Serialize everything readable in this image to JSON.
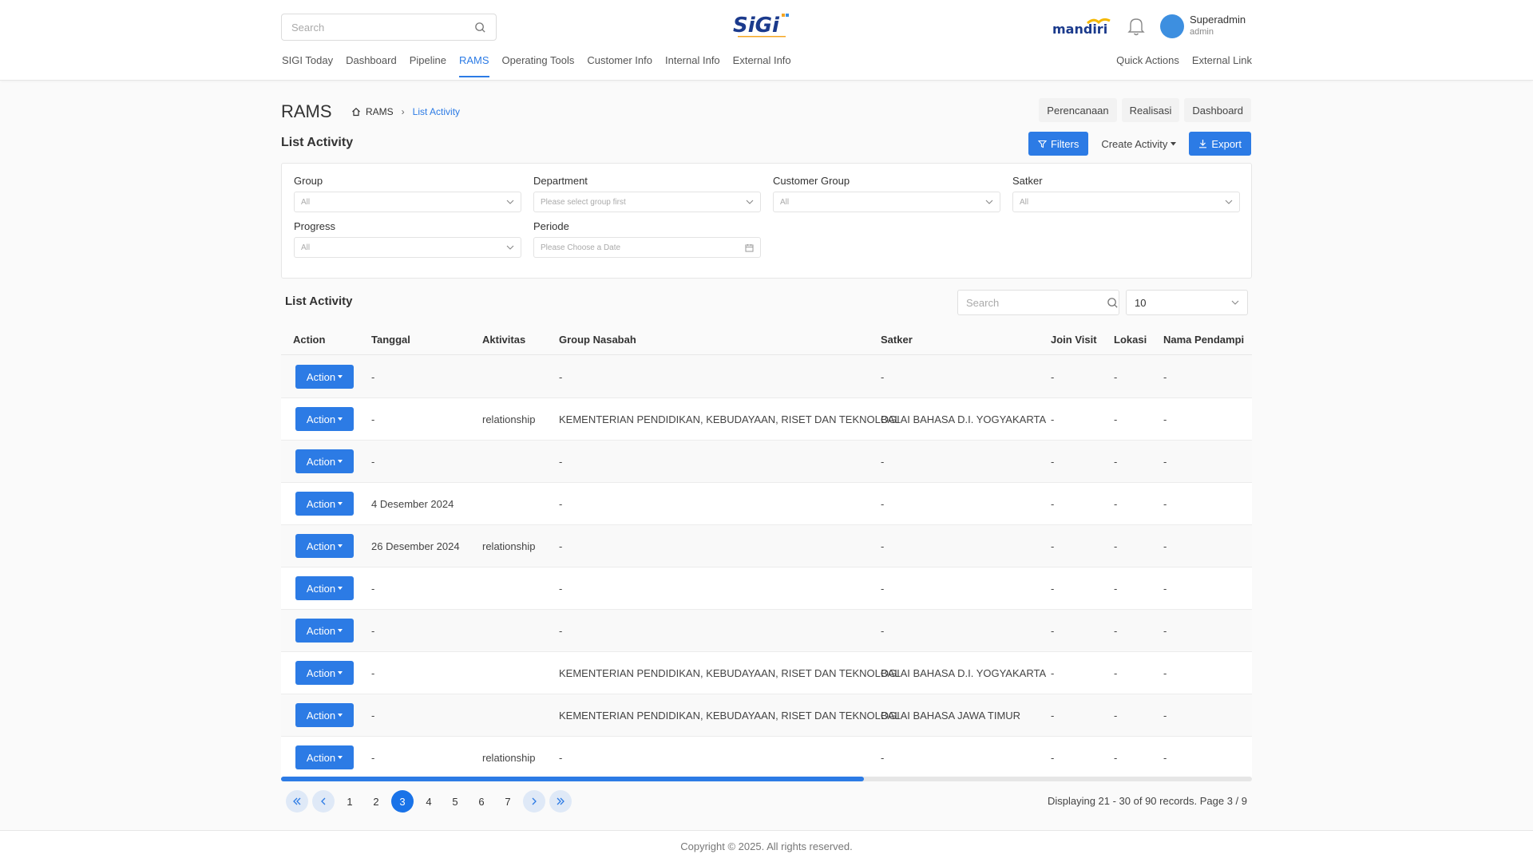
{
  "header": {
    "search_placeholder": "Search",
    "logo_text": "SiGi",
    "brand_text": "mandiri",
    "user": {
      "name": "Superadmin",
      "role": "admin"
    },
    "nav": [
      "SIGI Today",
      "Dashboard",
      "Pipeline",
      "RAMS",
      "Operating Tools",
      "Customer Info",
      "Internal Info",
      "External Info"
    ],
    "nav_active": "RAMS",
    "nav_right": [
      "Quick Actions",
      "External Link"
    ]
  },
  "page": {
    "title": "RAMS",
    "breadcrumb": {
      "root": "RAMS",
      "current": "List Activity"
    },
    "tabs": [
      "Perencanaan",
      "Realisasi",
      "Dashboard"
    ],
    "section_title": "List Activity",
    "buttons": {
      "filters": "Filters",
      "create": "Create Activity",
      "export": "Export"
    }
  },
  "filters": {
    "group": {
      "label": "Group",
      "value": "All"
    },
    "department": {
      "label": "Department",
      "placeholder": "Please select group first"
    },
    "customer_group": {
      "label": "Customer Group",
      "value": "All"
    },
    "satker": {
      "label": "Satker",
      "value": "All"
    },
    "progress": {
      "label": "Progress",
      "value": "All"
    },
    "periode": {
      "label": "Periode",
      "placeholder": "Please Choose a Date"
    }
  },
  "table": {
    "title": "List Activity",
    "search_placeholder": "Search",
    "page_size": "10",
    "action_label": "Action",
    "columns": [
      "Action",
      "Tanggal",
      "Aktivitas",
      "Group Nasabah",
      "Satker",
      "Join Visit",
      "Lokasi",
      "Nama Pendampi"
    ],
    "rows": [
      {
        "tanggal": "-",
        "aktivitas": "",
        "group": "-",
        "satker": "-",
        "join": "-",
        "lokasi": "-",
        "pendamping": "-"
      },
      {
        "tanggal": "-",
        "aktivitas": "relationship",
        "group": "KEMENTERIAN PENDIDIKAN, KEBUDAYAAN, RISET DAN TEKNOLOGI",
        "satker": "BALAI BAHASA D.I. YOGYAKARTA",
        "join": "-",
        "lokasi": "-",
        "pendamping": "-"
      },
      {
        "tanggal": "-",
        "aktivitas": "",
        "group": "-",
        "satker": "-",
        "join": "-",
        "lokasi": "-",
        "pendamping": "-"
      },
      {
        "tanggal": "4 Desember 2024",
        "aktivitas": "",
        "group": "-",
        "satker": "-",
        "join": "-",
        "lokasi": "-",
        "pendamping": "-"
      },
      {
        "tanggal": "26 Desember 2024",
        "aktivitas": "relationship",
        "group": "-",
        "satker": "-",
        "join": "-",
        "lokasi": "-",
        "pendamping": "-"
      },
      {
        "tanggal": "-",
        "aktivitas": "",
        "group": "-",
        "satker": "-",
        "join": "-",
        "lokasi": "-",
        "pendamping": "-"
      },
      {
        "tanggal": "-",
        "aktivitas": "",
        "group": "-",
        "satker": "-",
        "join": "-",
        "lokasi": "-",
        "pendamping": "-"
      },
      {
        "tanggal": "-",
        "aktivitas": "",
        "group": "KEMENTERIAN PENDIDIKAN, KEBUDAYAAN, RISET DAN TEKNOLOGI",
        "satker": "BALAI BAHASA D.I. YOGYAKARTA",
        "join": "-",
        "lokasi": "-",
        "pendamping": "-"
      },
      {
        "tanggal": "-",
        "aktivitas": "",
        "group": "KEMENTERIAN PENDIDIKAN, KEBUDAYAAN, RISET DAN TEKNOLOGI",
        "satker": "BALAI BAHASA JAWA TIMUR",
        "join": "-",
        "lokasi": "-",
        "pendamping": "-"
      },
      {
        "tanggal": "-",
        "aktivitas": "relationship",
        "group": "-",
        "satker": "-",
        "join": "-",
        "lokasi": "-",
        "pendamping": "-"
      }
    ]
  },
  "pagination": {
    "pages": [
      "1",
      "2",
      "3",
      "4",
      "5",
      "6",
      "7"
    ],
    "current": "3",
    "info": "Displaying 21 - 30 of 90 records. Page 3 / 9",
    "horizontal_scroll_fraction": 0.6
  },
  "footer": {
    "copyright": "Copyright © 2025. All rights reserved."
  },
  "colors": {
    "accent": "#2c7be5",
    "pager_bg": "#dfe9f7"
  }
}
